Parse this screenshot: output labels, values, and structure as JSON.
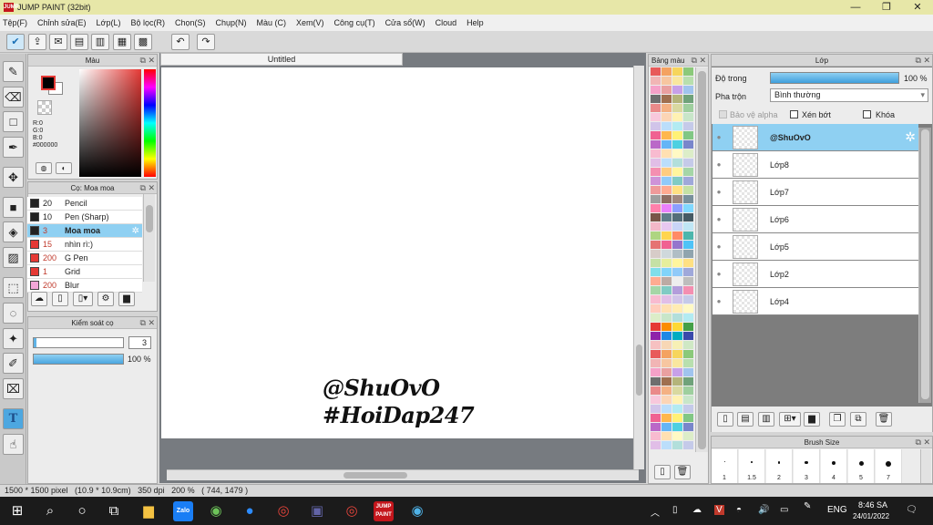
{
  "window": {
    "title": "JUMP PAINT (32bit)",
    "min": "—",
    "max": "❐",
    "close": "✕",
    "logo": "JUMP"
  },
  "menu": [
    "Tệp(F)",
    "Chỉnh sửa(E)",
    "Lớp(L)",
    "Bộ lọc(R)",
    "Chọn(S)",
    "Chụp(N)",
    "Màu (C)",
    "Xem(V)",
    "Công cụ(T)",
    "Cửa sổ(W)",
    "Cloud",
    "Help"
  ],
  "color_panel": {
    "title": "Màu",
    "r": "R:0",
    "g": "G:0",
    "b": "B:0",
    "hex": "#000000"
  },
  "brush_panel": {
    "title": "Cọ: Moa moa",
    "brushes": [
      {
        "size": "20",
        "name": "Pencil",
        "color": "#222222",
        "sizecolor": "#222"
      },
      {
        "size": "10",
        "name": "Pen (Sharp)",
        "color": "#222222",
        "sizecolor": "#222"
      },
      {
        "size": "3",
        "name": "Moa moa",
        "color": "#222222",
        "sizecolor": "#c0392b"
      },
      {
        "size": "15",
        "name": "nhìn rì:)",
        "color": "#e53935",
        "sizecolor": "#c0392b"
      },
      {
        "size": "200",
        "name": "G Pen",
        "color": "#e53935",
        "sizecolor": "#c0392b"
      },
      {
        "size": "1",
        "name": "Grid",
        "color": "#e53935",
        "sizecolor": "#c0392b"
      },
      {
        "size": "200",
        "name": "Blur",
        "color": "#f3a6d8",
        "sizecolor": "#c0392b"
      }
    ]
  },
  "brush_control": {
    "title": "Kiểm soát cọ",
    "size_value": "3",
    "opacity": "100 %"
  },
  "canvas": {
    "tab": "Untitled",
    "text": "@ShuOvO\n#HoiDap247"
  },
  "palette": {
    "title": "Bảng màu"
  },
  "layers": {
    "title": "Lớp",
    "opacity_label": "Độ trong",
    "opacity_value": "100 %",
    "blend_label": "Pha trộn",
    "blend_value": "Bình thường",
    "protect_alpha": "Bảo vệ alpha",
    "clipping": "Xén bớt",
    "lock": "Khóa",
    "items": [
      "@ShuOvO",
      "Lớp8",
      "Lớp7",
      "Lớp6",
      "Lớp5",
      "Lớp2",
      "Lớp4"
    ]
  },
  "brush_size": {
    "title": "Brush Size",
    "sizes": [
      "1",
      "1.5",
      "2",
      "3",
      "4",
      "5",
      "7"
    ]
  },
  "status": {
    "text": "1500 * 1500 pixel   (10.9 * 10.9cm)   350 dpi   200 %   ( 744, 1479 )"
  },
  "taskbar": {
    "lang": "ENG",
    "time": "8:46 SA",
    "date": "24/01/2022"
  }
}
